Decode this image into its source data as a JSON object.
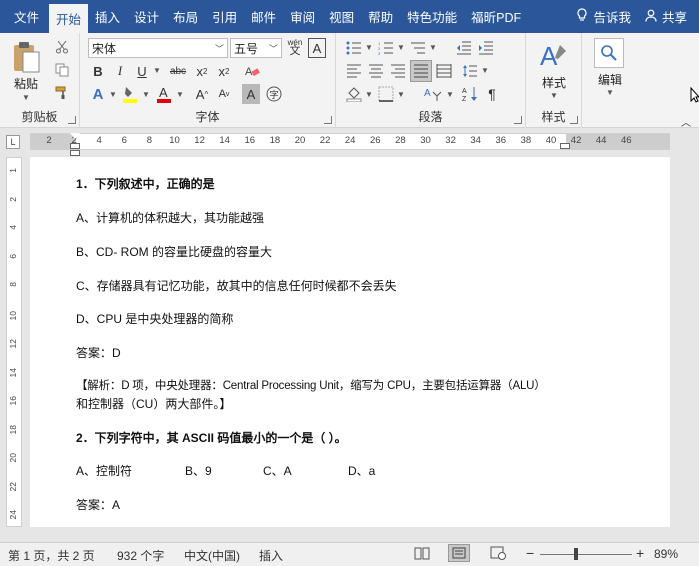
{
  "tabs": [
    "文件",
    "开始",
    "插入",
    "设计",
    "布局",
    "引用",
    "邮件",
    "审阅",
    "视图",
    "帮助",
    "特色功能",
    "福昕PDF"
  ],
  "active_tab_index": 1,
  "tell_me": "告诉我",
  "share": "共享",
  "ribbon": {
    "clipboard": {
      "label": "剪贴板",
      "paste": "粘贴"
    },
    "font": {
      "label": "字体",
      "font_name": "宋体",
      "font_size": "五号",
      "wen_icon": "wén\n文"
    },
    "paragraph": {
      "label": "段落"
    },
    "styles": {
      "label": "样式",
      "button": "样式"
    },
    "editing": {
      "button": "编辑"
    }
  },
  "ruler": {
    "numbers": [
      "2",
      "2",
      "4",
      "6",
      "8",
      "10",
      "12",
      "14",
      "16",
      "18",
      "20",
      "22",
      "24",
      "26",
      "28",
      "30",
      "32",
      "34",
      "36",
      "38",
      "40",
      "42",
      "44",
      "46"
    ]
  },
  "vruler": {
    "numbers": [
      "1",
      "2",
      "4",
      "6",
      "8",
      "10",
      "12",
      "14",
      "16",
      "18",
      "20",
      "22",
      "24"
    ]
  },
  "document": {
    "lines": [
      {
        "text": "1．下列叙述中，正确的是",
        "bold": true
      },
      {
        "text": "A、计算机的体积越大，其功能越强",
        "bold": false
      },
      {
        "text": "B、CD- ROM 的容量比硬盘的容量大",
        "bold": false
      },
      {
        "text": "C、存储器具有记忆功能，故其中的信息任何时候都不会丢失",
        "bold": false
      },
      {
        "text": "D、CPU 是中央处理器的简称",
        "bold": false
      },
      {
        "text": "答案：D",
        "bold": false
      },
      {
        "text": "【解析：D 项，中央处理器：Central Processing Unit，缩写为 CPU，主要包括运算器（ALU）",
        "bold": false
      },
      {
        "text": "和控制器（CU）两大部件。】",
        "bold": false
      },
      {
        "text": "2．下列字符中，其 ASCII 码值最小的一个是（  ）。",
        "bold": true
      },
      {
        "text": "A、控制符",
        "bold": false
      },
      {
        "text": "答案：A",
        "bold": false
      }
    ],
    "options_row": [
      "B、9",
      "C、A",
      "D、a"
    ]
  },
  "status": {
    "page": "第 1 页，共 2 页",
    "words": "932 个字",
    "language": "中文(中国)",
    "mode": "插入",
    "zoom": "89%"
  },
  "colors": {
    "tab_bar": "#2b579a",
    "ribbon_bg": "#f3f3f3",
    "highlight": "#ffff00",
    "font_color": "#e00000"
  }
}
